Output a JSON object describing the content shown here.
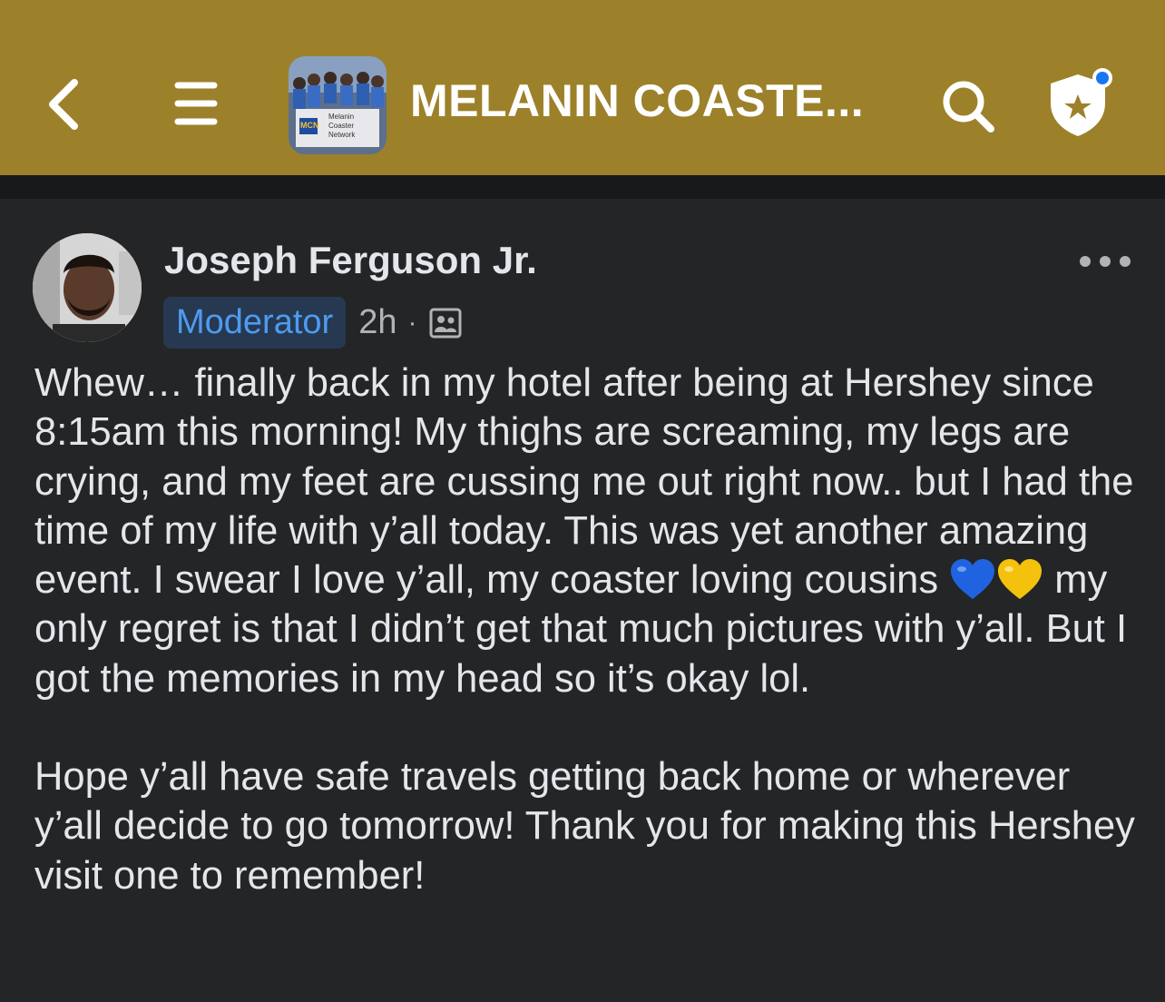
{
  "header": {
    "group_title": "MELANIN COASTE...",
    "thumb_label_line1": "Melanin",
    "thumb_label_line2": "Coaster",
    "thumb_label_line3": "Network",
    "thumb_badge": "MCN",
    "background_color": "#9c812a"
  },
  "icons": {
    "back": "chevron-left-icon",
    "menu": "hamburger-icon",
    "search": "search-icon",
    "admin": "shield-star-icon",
    "more": "more-horizontal-icon",
    "privacy": "members-icon"
  },
  "post": {
    "author": "Joseph Ferguson Jr.",
    "role_badge": "Moderator",
    "timestamp": "2h",
    "separator": "·",
    "body_part1": "Whew… finally back in my hotel after being at Hershey since 8:15am this morning! My thighs are screaming, my legs are crying, and my feet are cussing me out right now.. but I had the time of my life with y’all today. This was yet another amazing event. I swear I love y’all, my coaster loving cousins ",
    "body_part2": " my only regret is that I didn’t get that much pictures with y’all. But I got the memories in my head so it’s okay lol.",
    "body_paragraph2": "Hope y’all have safe travels getting back home or wherever y’all decide to go tomorrow! Thank you for making this Hershey visit one to remember!",
    "emoji": [
      "blue-heart",
      "yellow-heart"
    ]
  },
  "colors": {
    "accent_badge_bg": "#263951",
    "accent_badge_text": "#4e9bf0",
    "notification_dot": "#1877f2",
    "post_bg": "#242526"
  }
}
